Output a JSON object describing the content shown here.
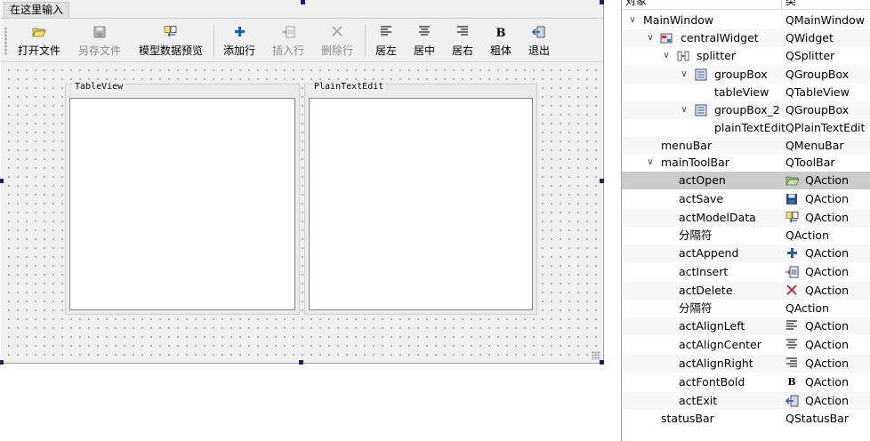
{
  "menu_bar": {
    "placeholder": "在这里输入"
  },
  "toolbar": {
    "buttons": [
      {
        "label": "打开文件",
        "icon": "folder-open-icon",
        "enabled": true
      },
      {
        "label": "另存文件",
        "icon": "save-icon",
        "enabled": false
      },
      {
        "label": "模型数据预览",
        "icon": "model-data-icon",
        "enabled": true
      },
      {
        "label": "添加行",
        "icon": "add-icon",
        "enabled": true
      },
      {
        "label": "插入行",
        "icon": "insert-row-icon",
        "enabled": false
      },
      {
        "label": "删除行",
        "icon": "delete-icon",
        "enabled": false
      },
      {
        "label": "居左",
        "icon": "align-left-icon",
        "enabled": true
      },
      {
        "label": "居中",
        "icon": "align-center-icon",
        "enabled": true
      },
      {
        "label": "居右",
        "icon": "align-right-icon",
        "enabled": true
      },
      {
        "label": "粗体",
        "icon": "bold-icon",
        "enabled": true
      },
      {
        "label": "退出",
        "icon": "exit-icon",
        "enabled": true
      }
    ]
  },
  "splitter": {
    "left_group": {
      "title": "TableView"
    },
    "right_group": {
      "title": "PlainTextEdit"
    }
  },
  "inspector": {
    "header": {
      "object_col": "对象",
      "class_col": "类"
    },
    "rows": [
      {
        "name": "MainWindow",
        "class": "QMainWindow",
        "expanded": true
      },
      {
        "name": "centralWidget",
        "class": "QWidget",
        "expanded": true,
        "icon": "central-widget-icon"
      },
      {
        "name": "splitter",
        "class": "QSplitter",
        "expanded": true,
        "icon": "splitter-icon"
      },
      {
        "name": "groupBox",
        "class": "QGroupBox",
        "expanded": true,
        "icon": "group-box-icon"
      },
      {
        "name": "tableView",
        "class": "QTableView"
      },
      {
        "name": "groupBox_2",
        "class": "QGroupBox",
        "expanded": true,
        "icon": "group-box-icon"
      },
      {
        "name": "plainTextEdit",
        "class": "QPlainTextEdit"
      },
      {
        "name": "menuBar",
        "class": "QMenuBar"
      },
      {
        "name": "mainToolBar",
        "class": "QToolBar",
        "expanded": true
      },
      {
        "name": "actOpen",
        "class": "QAction",
        "class_icon": "folder-open-icon",
        "selected": true
      },
      {
        "name": "actSave",
        "class": "QAction",
        "class_icon": "save-icon"
      },
      {
        "name": "actModelData",
        "class": "QAction",
        "class_icon": "model-data-icon"
      },
      {
        "name": "分隔符",
        "class": "QAction"
      },
      {
        "name": "actAppend",
        "class": "QAction",
        "class_icon": "add-icon"
      },
      {
        "name": "actInsert",
        "class": "QAction",
        "class_icon": "insert-row-icon"
      },
      {
        "name": "actDelete",
        "class": "QAction",
        "class_icon": "delete-icon"
      },
      {
        "name": "分隔符",
        "class": "QAction"
      },
      {
        "name": "actAlignLeft",
        "class": "QAction",
        "class_icon": "align-left-icon"
      },
      {
        "name": "actAlignCenter",
        "class": "QAction",
        "class_icon": "align-center-icon"
      },
      {
        "name": "actAlignRight",
        "class": "QAction",
        "class_icon": "align-right-icon"
      },
      {
        "name": "actFontBold",
        "class": "QAction",
        "class_icon": "bold-icon"
      },
      {
        "name": "actExit",
        "class": "QAction",
        "class_icon": "exit-icon"
      },
      {
        "name": "statusBar",
        "class": "QStatusBar"
      }
    ]
  },
  "colors": {
    "selection": "#cccccc",
    "add_icon": "#1a5fb4",
    "delete_icon": "#c01c28",
    "handle": "#1e1e6e"
  }
}
